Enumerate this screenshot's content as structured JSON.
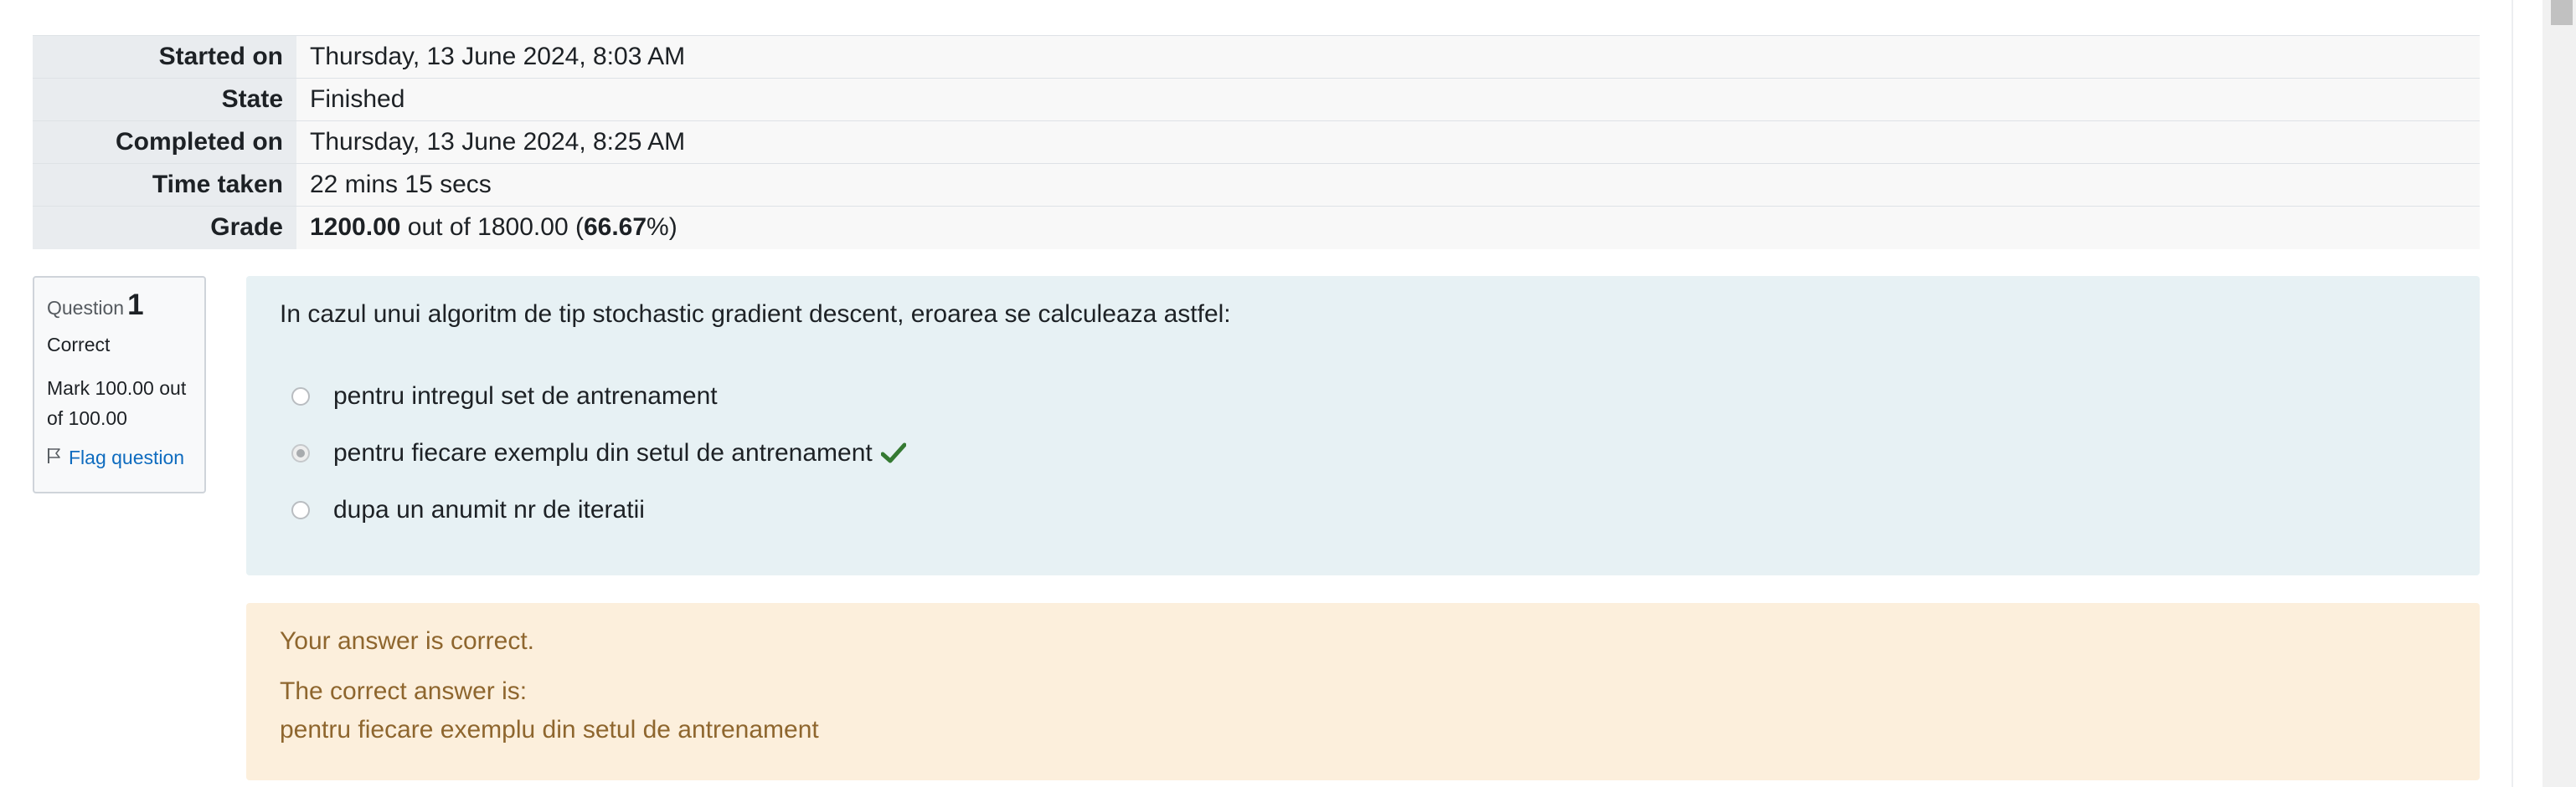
{
  "summary": {
    "started_label": "Started on",
    "started_value": "Thursday, 13 June 2024, 8:03 AM",
    "state_label": "State",
    "state_value": "Finished",
    "completed_label": "Completed on",
    "completed_value": "Thursday, 13 June 2024, 8:25 AM",
    "time_label": "Time taken",
    "time_value": "22 mins 15 secs",
    "grade_label": "Grade",
    "grade_score": "1200.00",
    "grade_mid": " out of 1800.00 (",
    "grade_percent": "66.67",
    "grade_end": "%)"
  },
  "question": {
    "number_label": "Question",
    "number": "1",
    "state": "Correct",
    "mark": "Mark 100.00 out of 100.00",
    "flag_label": "Flag question",
    "text": "In cazul unui algoritm de tip stochastic gradient descent, eroarea se calculeaza astfel:",
    "answers": [
      {
        "label": "pentru intregul set de antrenament",
        "selected": false
      },
      {
        "label": "pentru fiecare exemplu din setul de antrenament",
        "selected": true,
        "icon": "check-icon"
      },
      {
        "label": "dupa un anumit nr de iteratii",
        "selected": false
      }
    ]
  },
  "feedback": {
    "specific": "Your answer is correct.",
    "right_answer_intro": "The correct answer is:",
    "right_answer": "pentru fiecare exemplu din setul de antrenament"
  },
  "colors": {
    "formulation_bg": "#e7f1f4",
    "feedback_bg": "#fcefdc",
    "feedback_text": "#8e662e",
    "link": "#0f6cbf",
    "correct": "#357a32"
  }
}
